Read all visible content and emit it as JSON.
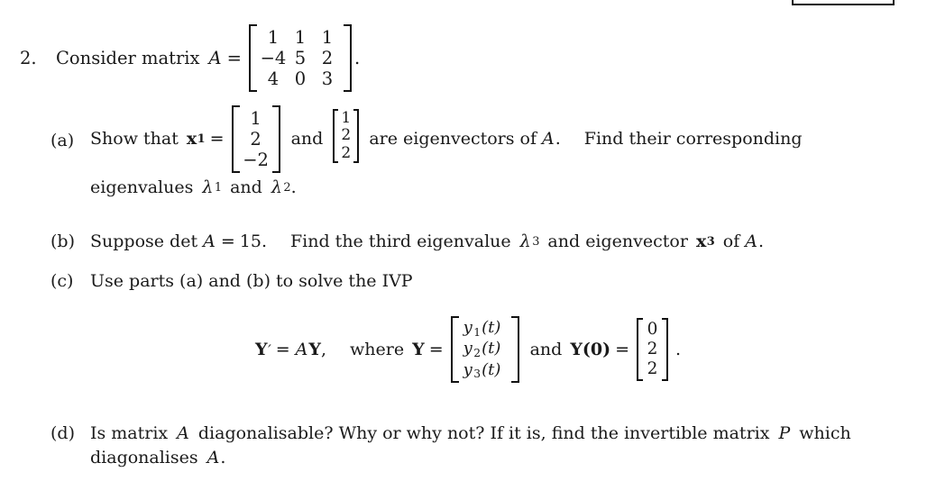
{
  "document": {
    "type": "math-exercise",
    "question_number": "2.",
    "stem": {
      "lead_text": "Consider matrix",
      "matrix_symbol": "A",
      "equals": "=",
      "matrix": {
        "rows": [
          [
            "1",
            "1",
            "1"
          ],
          [
            "−4",
            "5",
            "2"
          ],
          [
            "4",
            "0",
            "3"
          ]
        ]
      },
      "trailing_punctuation": "."
    },
    "parts": [
      {
        "label": "(a)",
        "line1": {
          "text_before": "Show that",
          "vector_symbol": "x",
          "vector_subscript": "1",
          "equals": "=",
          "vector1": [
            "1",
            "2",
            "−2"
          ],
          "conjunction": "and",
          "vector2": [
            "1",
            "2",
            "2"
          ],
          "text_after": "are eigenvectors of",
          "matrix_symbol": "A",
          "sentence_end": ".",
          "text_tail": "Find their corresponding"
        },
        "line2": {
          "text_before": "eigenvalues",
          "lambda1": "λ",
          "lambda1_sub": "1",
          "conjunction": "and",
          "lambda2": "λ",
          "lambda2_sub": "2",
          "sentence_end": "."
        }
      },
      {
        "label": "(b)",
        "line1": {
          "text_before": "Suppose det",
          "matrix_symbol": "A",
          "equals": "=",
          "determinant_value": "15",
          "period": ".",
          "text_mid": "Find the third eigenvalue",
          "lambda3": "λ",
          "lambda3_sub": "3",
          "text_mid2": "and eigenvector",
          "vector_symbol": "x",
          "vector_subscript": "3",
          "text_after": "of",
          "matrix_symbol2": "A",
          "sentence_end": "."
        }
      },
      {
        "label": "(c)",
        "line1": {
          "text": "Use parts (a) and (b) to solve the IVP"
        },
        "equation": {
          "lhs_vector": "Y",
          "prime": "′",
          "equals": "=",
          "matrix_symbol": "A",
          "rhs_vector": "Y",
          "comma": ",",
          "where_text": "where",
          "y_symbol": "Y",
          "equals2": "=",
          "y_components": [
            "y₁(t)",
            "y₂(t)",
            "y₃(t)"
          ],
          "y_components_parts": [
            {
              "base": "y",
              "sub": "1",
              "arg": "(t)"
            },
            {
              "base": "y",
              "sub": "2",
              "arg": "(t)"
            },
            {
              "base": "y",
              "sub": "3",
              "arg": "(t)"
            }
          ],
          "conjunction": "and",
          "initial_symbol": "Y",
          "initial_arg": "(0)",
          "equals3": "=",
          "initial_vector": [
            "0",
            "2",
            "2"
          ],
          "trailing_punctuation": "."
        }
      },
      {
        "label": "(d)",
        "line1": {
          "text_before": "Is matrix",
          "matrix_symbol": "A",
          "text_mid": "diagonalisable? Why or why not? If it is, find the invertible matrix",
          "p_symbol": "P",
          "text_after": "which"
        },
        "line2": {
          "text_before": "diagonalises",
          "matrix_symbol": "A",
          "sentence_end": "."
        }
      }
    ]
  },
  "artifacts": {
    "top_right_box": {
      "description": "cropped-rectangle-outline",
      "color": "#111111"
    }
  },
  "colors": {
    "page_background": "#ffffff",
    "text": "#1a1a1a",
    "rule": "#111111"
  }
}
